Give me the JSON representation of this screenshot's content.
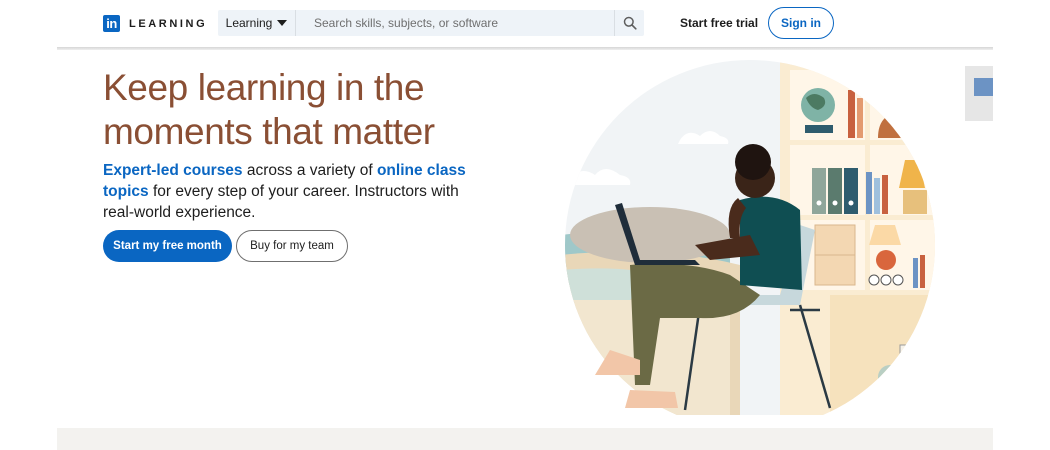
{
  "header": {
    "logo_badge": "in",
    "logo_text": "LEARNING",
    "search_category": "Learning",
    "search_placeholder": "Search skills, subjects, or software",
    "trial_link": "Start free trial",
    "signin": "Sign in"
  },
  "hero": {
    "title": "Keep learning in the moments that matter",
    "subtitle": {
      "part1": "Expert-led courses",
      "part2": " across a variety of ",
      "part3": "online class topics",
      "part4": " for every step of your career. Instructors with real-world experience."
    },
    "primary_button": "Start my free month",
    "secondary_button": "Buy for my team"
  },
  "colors": {
    "brand": "#0a66c2",
    "title": "#8a4f34",
    "footer_band": "#f3f2ef"
  },
  "icons": [
    "linkedin-logo-icon",
    "caret-down-icon",
    "search-icon"
  ]
}
